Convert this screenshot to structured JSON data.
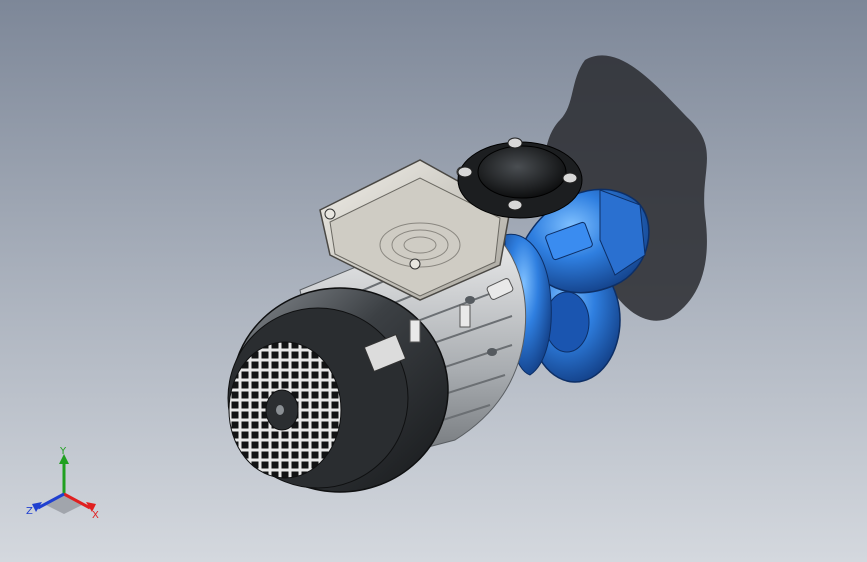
{
  "viewport": {
    "background_top": "#7d8798",
    "background_bottom": "#d4d8de"
  },
  "model": {
    "housing_color": "#2f7fe0",
    "motor_color": "#9aa0a6",
    "fan_cover_color": "#3a3d40",
    "terminal_box_color": "#d9d6cf",
    "cap_color": "#1f2224"
  },
  "triad": {
    "x_label": "X",
    "y_label": "Y",
    "z_label": "Z",
    "x_color": "#e02020",
    "y_color": "#20a020",
    "z_color": "#2040d0"
  }
}
